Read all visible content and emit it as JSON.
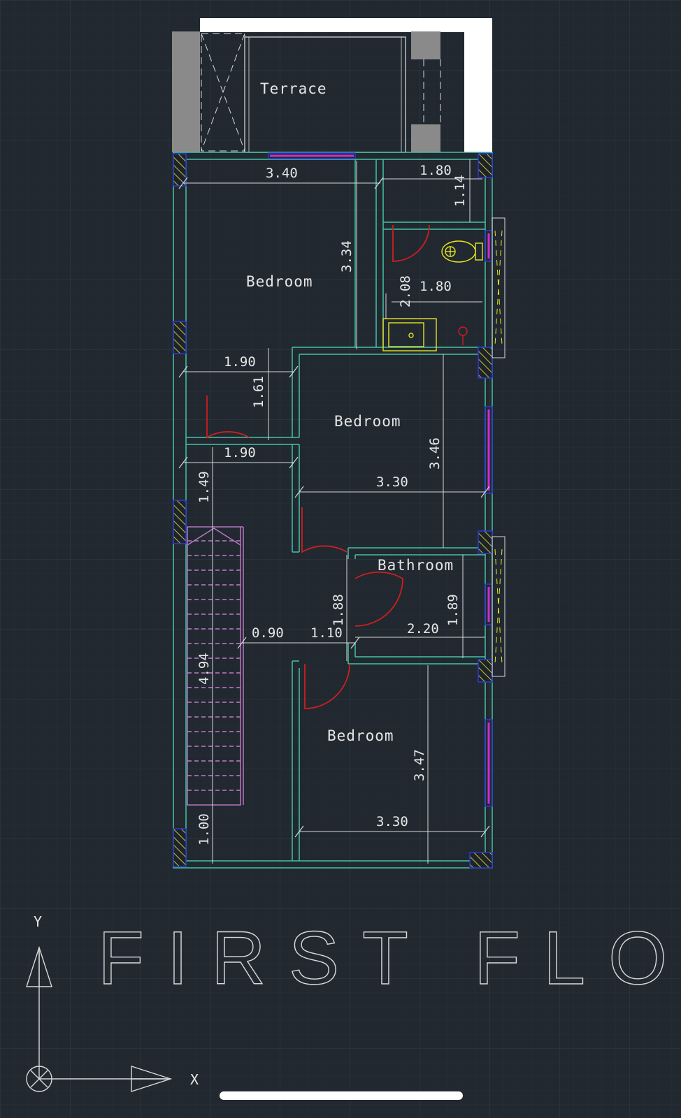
{
  "drawing": {
    "title": "FIRST FLOOR",
    "rooms": {
      "terrace": "Terrace",
      "bedroom_top": "Bedroom",
      "bedroom_mid": "Bedroom",
      "bathroom": "Bathroom",
      "bedroom_bottom": "Bedroom"
    },
    "dimensions": {
      "d_340": "3.40",
      "d_180_top": "1.80",
      "d_114": "1.14",
      "d_334": "3.34",
      "d_208": "2.08",
      "d_180_wc": "1.80",
      "d_190_a": "1.90",
      "d_161": "1.61",
      "d_190_b": "1.90",
      "d_346": "3.46",
      "d_330_a": "3.30",
      "d_149": "1.49",
      "d_188": "1.88",
      "d_189": "1.89",
      "d_090": "0.90",
      "d_110": "1.10",
      "d_220": "2.20",
      "d_494": "4.94",
      "d_347": "3.47",
      "d_330_b": "3.30",
      "d_100": "1.00"
    },
    "ucs": {
      "y_label": "Y",
      "x_label": "X"
    }
  },
  "colors": {
    "background": "#212830",
    "grid": "#2e3640",
    "wall": "#46c3a5",
    "dimension": "#d8d8d8",
    "door": "#cc1f1f",
    "window": "#d12bd1",
    "stairs": "#c27bc9",
    "fixtures": "#e6e61e",
    "column_hatch": "#c9c22b",
    "terrace_fill": "#8a8a8a",
    "parapet": "#ffffff"
  },
  "icons": [
    "toilet-icon",
    "sink-icon",
    "ucs-icon"
  ]
}
